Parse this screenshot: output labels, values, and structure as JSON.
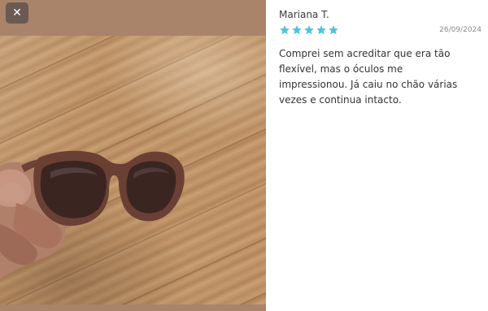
{
  "close_button": {
    "icon": "close-icon",
    "label": "✕"
  },
  "review": {
    "reviewer_name": "Mariana T.",
    "rating": 5,
    "rating_max": 5,
    "star_color": "#4fc3e0",
    "date": "26/09/2024",
    "text": "Comprei sem acreditar que era tão flexível, mas o óculos me impressionou. Já caiu no chão várias vezes e continua intacto."
  },
  "media": {
    "image_subject": "sunglasses-photo"
  }
}
